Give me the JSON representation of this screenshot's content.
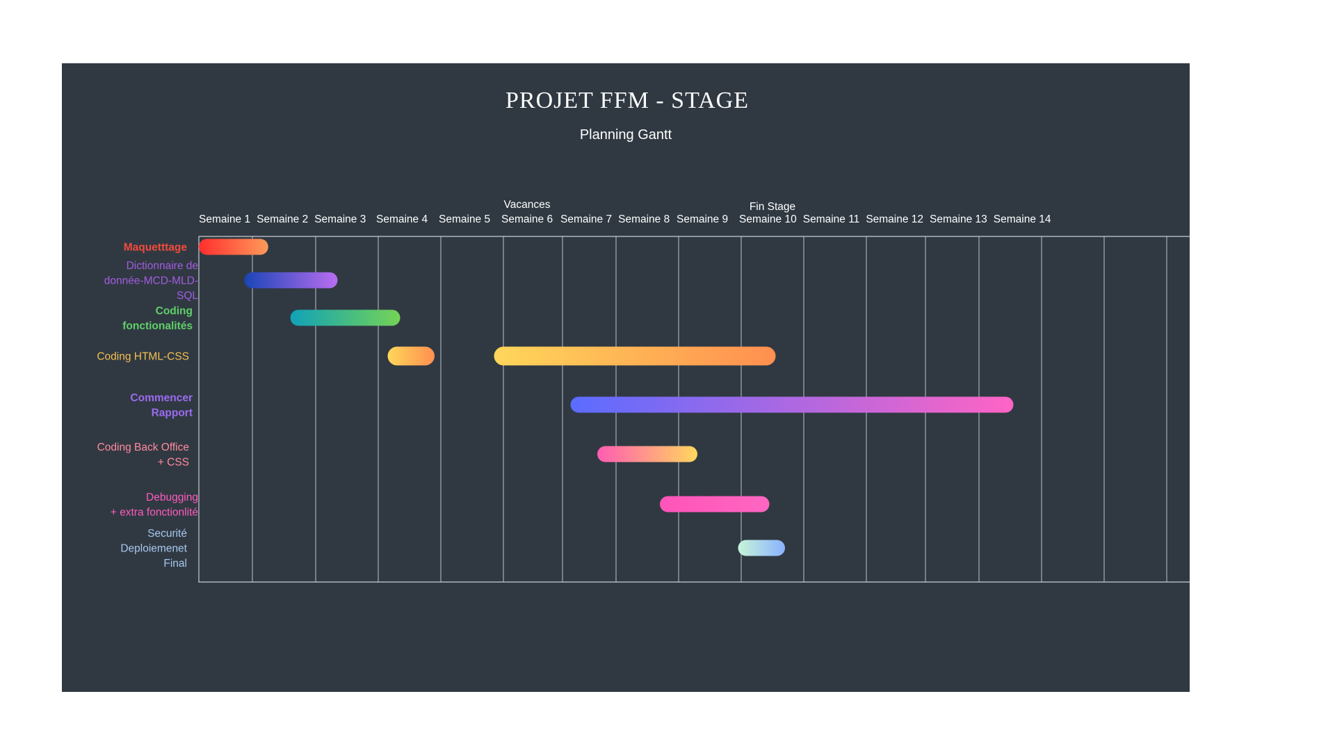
{
  "title": "PROJET FFM - STAGE",
  "subtitle": "Planning Gantt",
  "chart_data": {
    "type": "gantt",
    "title": "PROJET FFM - STAGE",
    "subtitle": "Planning Gantt",
    "x_axis": {
      "unit": "week",
      "range": [
        0,
        16
      ],
      "tick_labels": [
        "Semaine 1",
        "Semaine 2",
        "Semaine 3",
        "Semaine 4",
        "Semaine 5",
        "Semaine 6",
        "Semaine 7",
        "Semaine 8",
        "Semaine 9",
        "Semaine 10",
        "Semaine 11",
        "Semaine 12",
        "Semaine 13",
        "Semaine 14"
      ],
      "grid": true
    },
    "markers": [
      {
        "label": "Vacances",
        "week": 5.4
      },
      {
        "label": "Fin Stage",
        "week": 9.5
      }
    ],
    "tasks": [
      {
        "label": "Maquetttage",
        "bold": true,
        "color": "#f24a3c",
        "segments": [
          {
            "start": 0.0,
            "end": 1.25
          }
        ],
        "gradient": [
          "#ff2e2e",
          "#ff9a5a"
        ]
      },
      {
        "label": "Dictionnaire de donnée-MCD-MLD-SQL",
        "bold": false,
        "color": "#a35ce0",
        "segments": [
          {
            "start": 0.85,
            "end": 2.35
          }
        ],
        "gradient": [
          "#1a45b8",
          "#b96ef0"
        ]
      },
      {
        "label": "Coding fonctionalités",
        "bold": true,
        "color": "#5fd068",
        "segments": [
          {
            "start": 1.6,
            "end": 3.35
          }
        ],
        "gradient": [
          "#10a2b8",
          "#75d355"
        ]
      },
      {
        "label": "Coding HTML-CSS",
        "bold": false,
        "color": "#f5bf50",
        "segments": [
          {
            "start": 3.15,
            "end": 3.9
          },
          {
            "start": 4.85,
            "end": 9.55
          }
        ],
        "gradient": [
          "#ffd75a",
          "#ff8f50"
        ]
      },
      {
        "label": "Commencer Rapport",
        "bold": true,
        "color": "#9b6bf0",
        "segments": [
          {
            "start": 6.15,
            "end": 13.55
          }
        ],
        "gradient": [
          "#5b6cff",
          "#ff64c4"
        ]
      },
      {
        "label": "Coding Back Office + CSS",
        "bold": false,
        "color": "#ff8a9e",
        "segments": [
          {
            "start": 6.65,
            "end": 8.3
          }
        ],
        "gradient": [
          "#ff5cb2",
          "#ffd75e"
        ]
      },
      {
        "label": "Debugging + extra fonctionlité",
        "bold": false,
        "color": "#ff5bbd",
        "segments": [
          {
            "start": 7.7,
            "end": 9.45
          }
        ],
        "gradient": [
          "#ff54b8",
          "#ff66c2"
        ]
      },
      {
        "label": "Securité Deploiemenet Final",
        "bold": false,
        "color": "#a9c7f0",
        "segments": [
          {
            "start": 8.95,
            "end": 9.7
          }
        ],
        "gradient": [
          "#c8f5d8",
          "#8ab2ff"
        ]
      }
    ]
  }
}
